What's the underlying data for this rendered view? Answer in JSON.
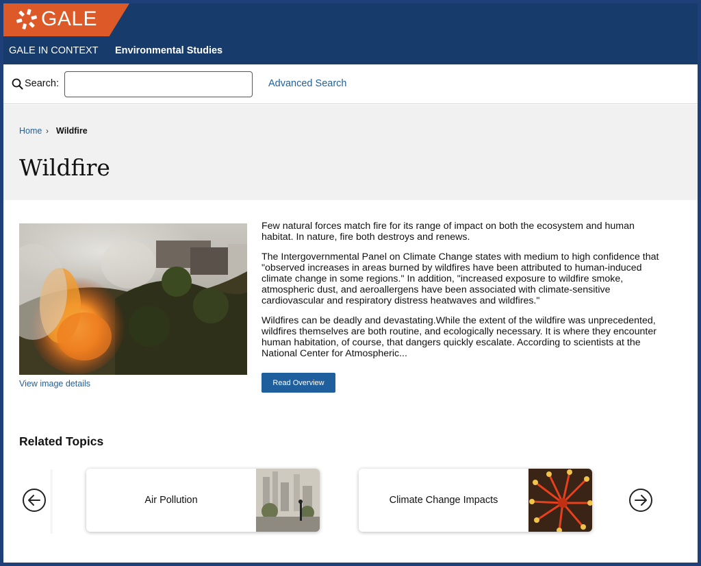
{
  "header": {
    "logo_text": "GALE",
    "product": "GALE IN CONTEXT",
    "collection": "Environmental Studies"
  },
  "search": {
    "label": "Search:",
    "value": "",
    "placeholder": "",
    "advanced_label": "Advanced Search"
  },
  "breadcrumb": {
    "home": "Home",
    "separator": "›",
    "current": "Wildfire"
  },
  "page": {
    "title": "Wildfire",
    "image_details_link": "View image details",
    "paragraphs": [
      "Few natural forces match fire for its range of impact on both the ecosystem and human habitat. In nature, fire both destroys and renews.",
      "The Intergovernmental Panel on Climate Change states with medium to high confidence that \"observed increases in areas burned by wildfires have been attributed to human-induced climate change in some regions.\" In addition, \"increased exposure to wildfire smoke, atmospheric dust, and aeroallergens have been associated with climate-sensitive cardiovascular and respiratory distress heatwaves and wildfires.\"",
      "Wildfires can be deadly and devastating.While the extent of the wildfire was unprecedented, wildfires themselves are both routine, and ecologically necessary. It is where they encounter human habitation, of course, that dangers quickly escalate. According to scientists at the National Center for Atmospheric..."
    ],
    "read_button": "Read Overview"
  },
  "related": {
    "title": "Related Topics",
    "cards": [
      {
        "label": "Air Pollution"
      },
      {
        "label": "Climate Change Impacts"
      }
    ]
  },
  "colors": {
    "header_bg": "#173c6b",
    "logo_orange": "#dd5a28",
    "link_blue": "#1f5f9e",
    "hero_bg": "#f1f1f1"
  },
  "icons": {
    "logo": "gale-logo-icon",
    "search": "search-icon",
    "prev": "arrow-left-circle-icon",
    "next": "arrow-right-circle-icon"
  }
}
